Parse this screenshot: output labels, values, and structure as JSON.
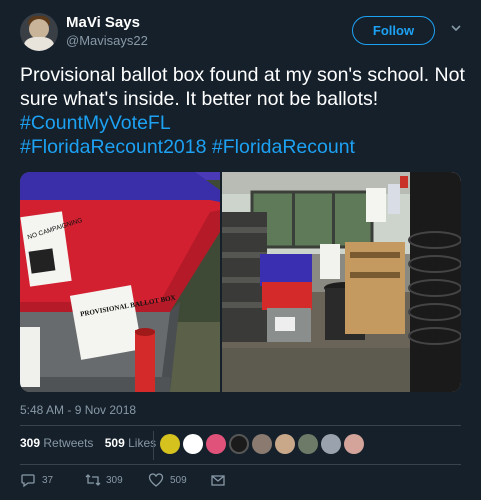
{
  "author": {
    "name": "MaVi Says",
    "handle": "@Mavisays22"
  },
  "follow_label": "Follow",
  "tweet": {
    "text_plain": "Provisional ballot box found at my son's school. Not sure what's inside. It better not be ballots! ",
    "hashtags": [
      "#CountMyVoteFL",
      "#FloridaRecount2018",
      "#FloridaRecount"
    ]
  },
  "photos": {
    "left": {
      "sign_top": "NO CAMPAIGNING",
      "sign_box": "PROVISIONAL BALLOT BOX"
    },
    "right": {}
  },
  "timestamp": "5:48 AM - 9 Nov 2018",
  "stats": {
    "retweets_count": "309",
    "retweets_label": "Retweets",
    "likes_count": "509",
    "likes_label": "Likes"
  },
  "actions": {
    "reply_count": "37",
    "retweet_count": "309",
    "like_count": "509"
  },
  "colors": {
    "background": "#15202b",
    "accent": "#1da1f2",
    "muted": "#8899a6",
    "divider": "#38444d"
  }
}
